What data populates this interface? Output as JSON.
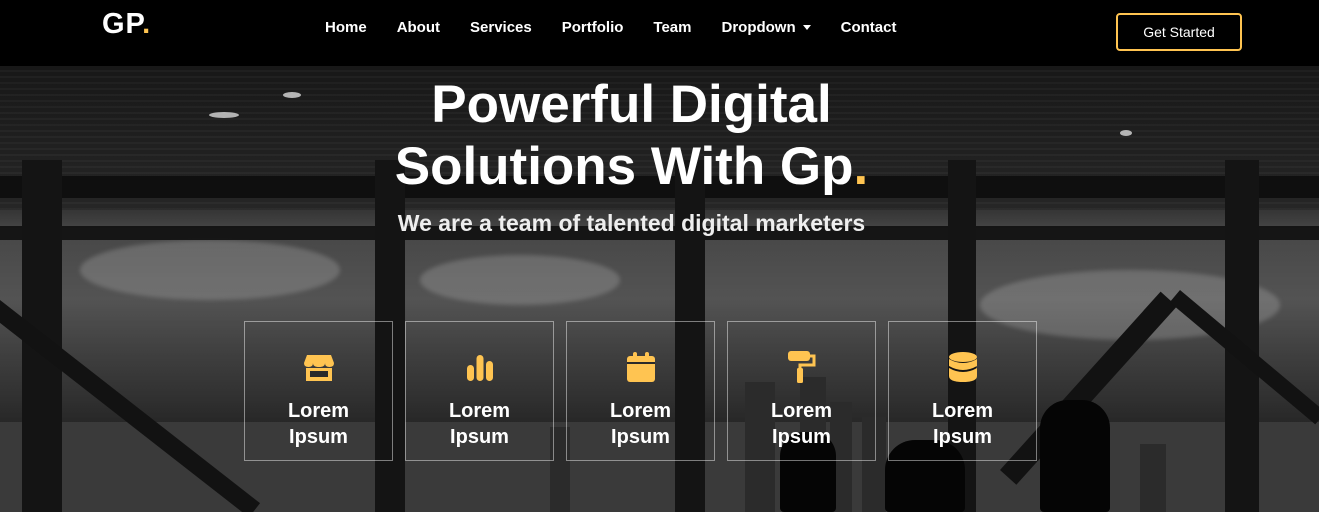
{
  "brand": {
    "name": "GP",
    "dot": "."
  },
  "nav": {
    "items": [
      {
        "label": "Home"
      },
      {
        "label": "About"
      },
      {
        "label": "Services"
      },
      {
        "label": "Portfolio"
      },
      {
        "label": "Team"
      },
      {
        "label": "Dropdown",
        "has_caret": true
      },
      {
        "label": "Contact"
      }
    ]
  },
  "header": {
    "cta_label": "Get Started"
  },
  "hero": {
    "title_line1": "Powerful Digital",
    "title_line2": "Solutions With Gp",
    "title_dot": ".",
    "subtitle": "We are a team of talented digital marketers"
  },
  "icon_boxes": [
    {
      "icon": "store-icon",
      "label": "Lorem Ipsum"
    },
    {
      "icon": "bar-chart-icon",
      "label": "Lorem Ipsum"
    },
    {
      "icon": "calendar-icon",
      "label": "Lorem Ipsum"
    },
    {
      "icon": "paint-roller-icon",
      "label": "Lorem Ipsum"
    },
    {
      "icon": "database-icon",
      "label": "Lorem Ipsum"
    }
  ],
  "colors": {
    "accent": "#ffc451",
    "header_bg": "#000000",
    "text": "#ffffff"
  }
}
